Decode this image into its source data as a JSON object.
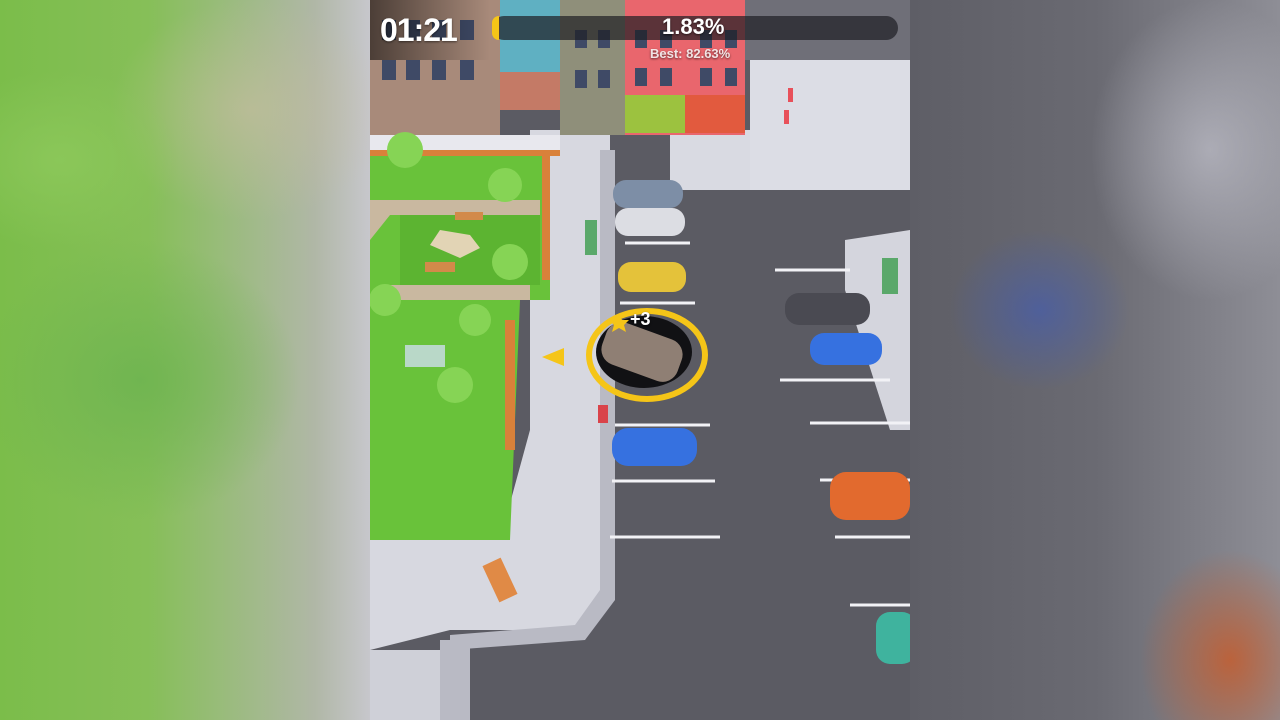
{
  "hud": {
    "timer": "01:21",
    "progress_percent": "1.83%",
    "progress_fraction": 0.0183,
    "best_label": "Best: 82.63%"
  },
  "player": {
    "score_popup": "+3"
  },
  "colors": {
    "accent": "#f5c518",
    "asphalt": "#5b5b63",
    "grass": "#69c23a",
    "sidewalk": "#d7d8e0"
  },
  "icons": {
    "direction_arrow": "arrow-left-icon",
    "star": "star-icon"
  }
}
